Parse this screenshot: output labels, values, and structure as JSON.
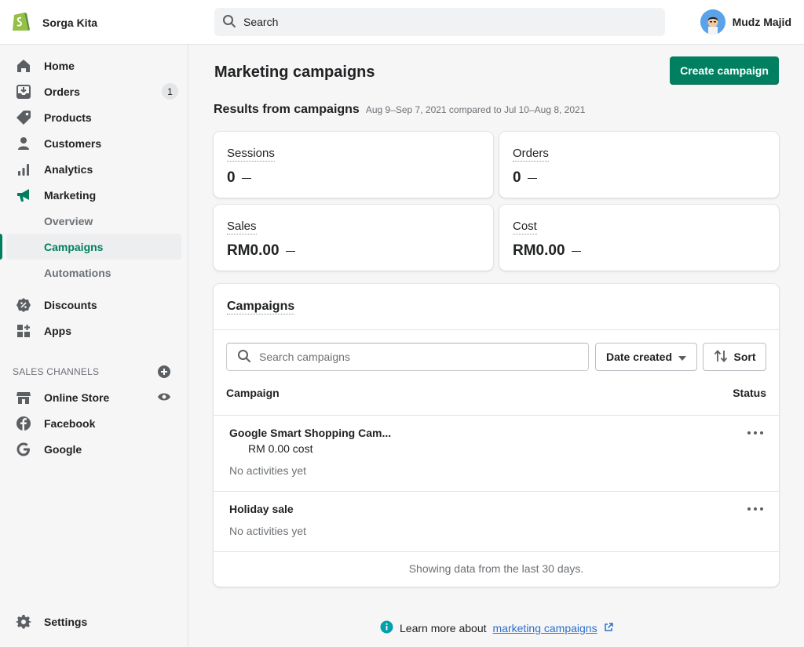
{
  "store": {
    "name": "Sorga Kita"
  },
  "search": {
    "placeholder": "Search"
  },
  "user": {
    "name": "Mudz Majid"
  },
  "nav": {
    "home": "Home",
    "orders": "Orders",
    "orders_badge": "1",
    "products": "Products",
    "customers": "Customers",
    "analytics": "Analytics",
    "marketing": "Marketing",
    "overview": "Overview",
    "campaigns": "Campaigns",
    "automations": "Automations",
    "discounts": "Discounts",
    "apps": "Apps",
    "sales_channels": "SALES CHANNELS",
    "online_store": "Online Store",
    "facebook": "Facebook",
    "google": "Google",
    "settings": "Settings"
  },
  "page": {
    "title": "Marketing campaigns",
    "create_button": "Create campaign",
    "results_title": "Results from campaigns",
    "results_range": "Aug 9–Sep 7, 2021 compared to Jul 10–Aug 8, 2021"
  },
  "metrics": [
    {
      "label": "Sessions",
      "value": "0"
    },
    {
      "label": "Orders",
      "value": "0"
    },
    {
      "label": "Sales",
      "value": "RM0.00"
    },
    {
      "label": "Cost",
      "value": "RM0.00"
    }
  ],
  "campaigns": {
    "title": "Campaigns",
    "search_placeholder": "Search campaigns",
    "date_filter": "Date created",
    "sort_label": "Sort",
    "col_campaign": "Campaign",
    "col_status": "Status",
    "rows": [
      {
        "name": "Google Smart Shopping Cam...",
        "cost": "RM 0.00 cost",
        "activity": "No activities yet"
      },
      {
        "name": "Holiday sale",
        "activity": "No activities yet"
      }
    ],
    "footer": "Showing data from the last 30 days."
  },
  "learn": {
    "prefix": "Learn more about",
    "link": "marketing campaigns"
  },
  "colors": {
    "accent": "#008060",
    "active_nav": "#007f5f",
    "link": "#2c6ecb"
  }
}
